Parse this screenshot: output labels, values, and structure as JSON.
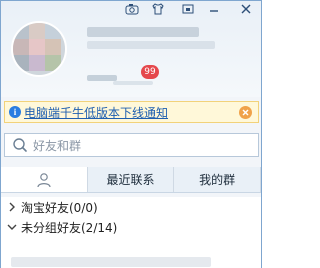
{
  "notice": {
    "text": "电脑端千牛低版本下线通知"
  },
  "profile": {
    "unread_count": "99"
  },
  "search": {
    "placeholder": "好友和群"
  },
  "tabs": [
    {
      "label": ""
    },
    {
      "label": "最近联系"
    },
    {
      "label": "我的群"
    }
  ],
  "groups": [
    {
      "label": "淘宝好友(0/0)",
      "expanded": false
    },
    {
      "label": "未分组好友(2/14)",
      "expanded": true
    }
  ],
  "colors": {
    "notice_bg": "#fff8d9",
    "badge_red": "#e5484d",
    "link_blue": "#1f5fb0",
    "close_orange": "#f0a24a"
  },
  "icons": {
    "toolbar": [
      "camera-icon",
      "shirt-icon",
      "box-icon",
      "minimize-icon",
      "close-icon"
    ],
    "notice": "info-icon",
    "notice_close": "close-icon",
    "search": "search-icon",
    "contacts_tab": "user-icon"
  }
}
